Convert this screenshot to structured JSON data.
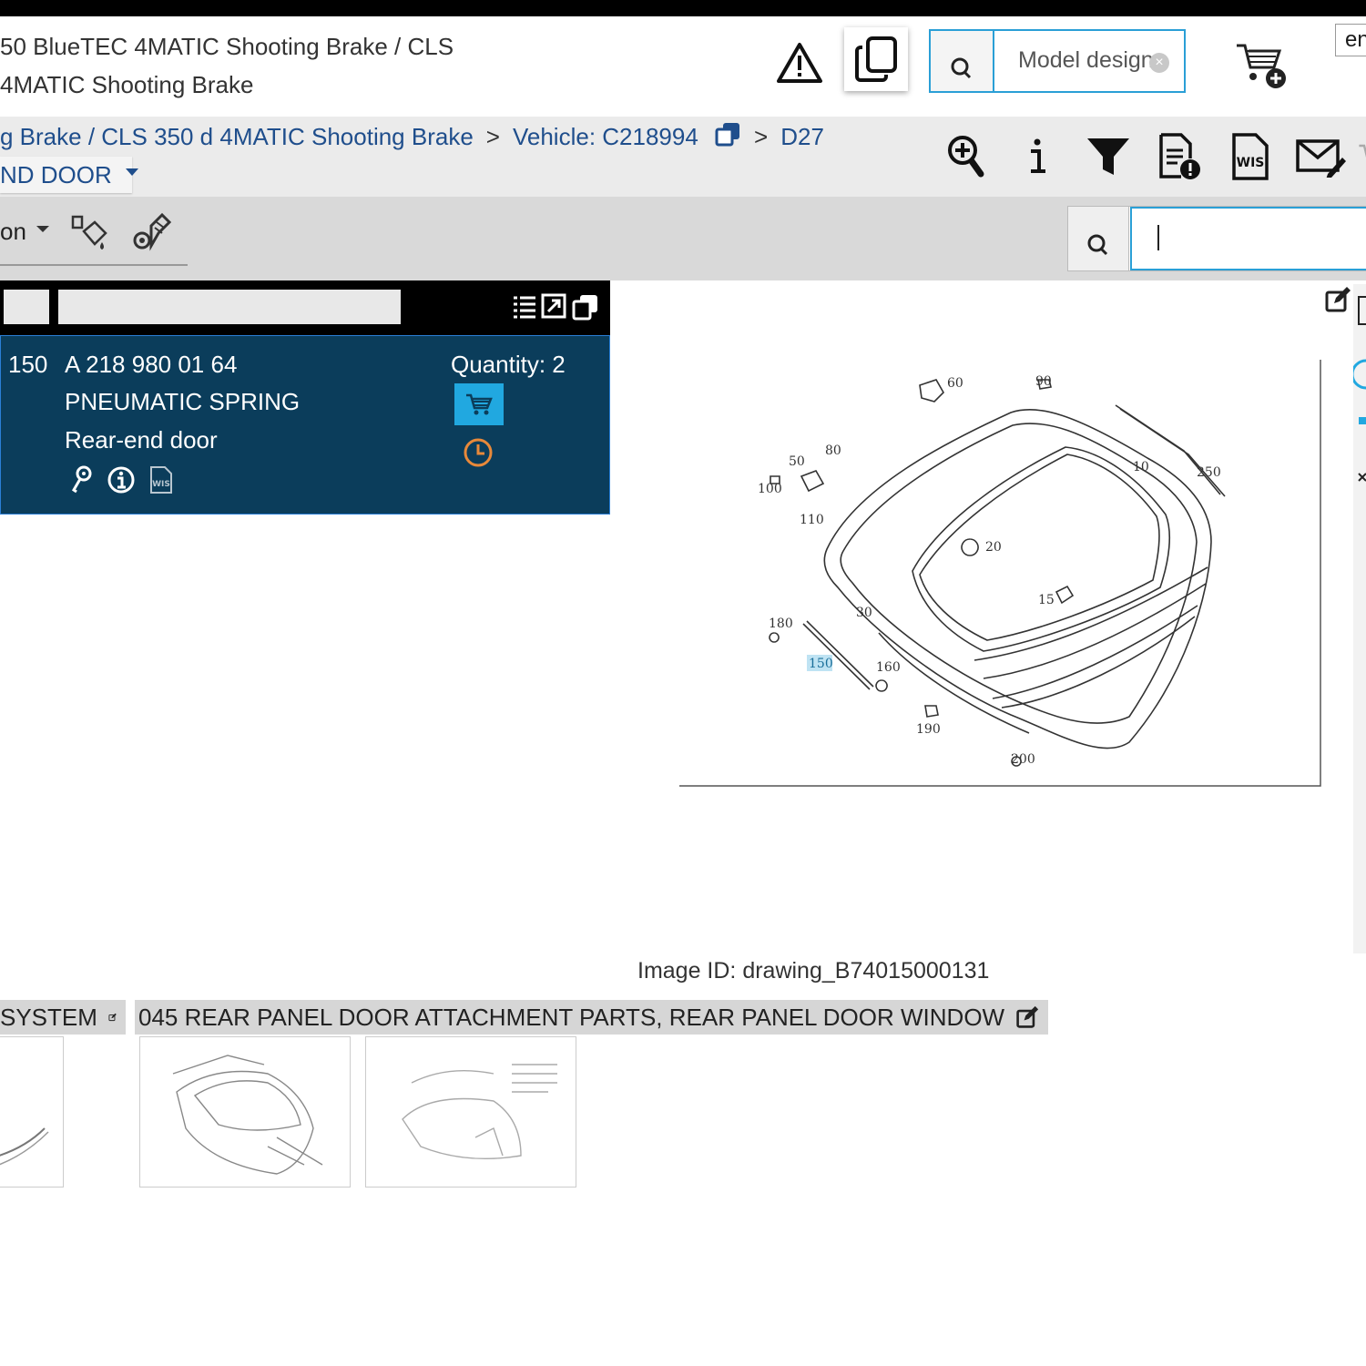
{
  "header": {
    "model_line1": "50 BlueTEC 4MATIC Shooting Brake / CLS",
    "model_line2": "4MATIC Shooting Brake",
    "model_search_placeholder": "Model design",
    "language": "en"
  },
  "breadcrumb": {
    "model": "g Brake / CLS 350 d 4MATIC Shooting Brake",
    "sep": ">",
    "vehicle": "Vehicle: C218994",
    "group": "D27",
    "dropdown": "ND DOOR"
  },
  "toolbar2": {
    "partial_label": "on"
  },
  "part": {
    "position": "150",
    "number": "A 218 980 01 64",
    "name": "PNEUMATIC SPRING",
    "description": "Rear-end door",
    "quantity": "Quantity: 2"
  },
  "drawing": {
    "callouts": [
      "60",
      "90",
      "50",
      "80",
      "100",
      "110",
      "10",
      "250",
      "20",
      "15",
      "30",
      "180",
      "150",
      "160",
      "190",
      "200"
    ],
    "highlighted": "150",
    "image_id": "Image ID: drawing_B74015000131"
  },
  "tabs": [
    {
      "label": "SYSTEM"
    },
    {
      "label": "045 REAR PANEL DOOR ATTACHMENT PARTS, REAR PANEL DOOR WINDOW"
    }
  ],
  "colors": {
    "accent": "#2a9fd6",
    "panel": "#0b3d5b",
    "cart": "#21a8e0",
    "history": "#e8893a",
    "link": "#1f4e8c"
  }
}
